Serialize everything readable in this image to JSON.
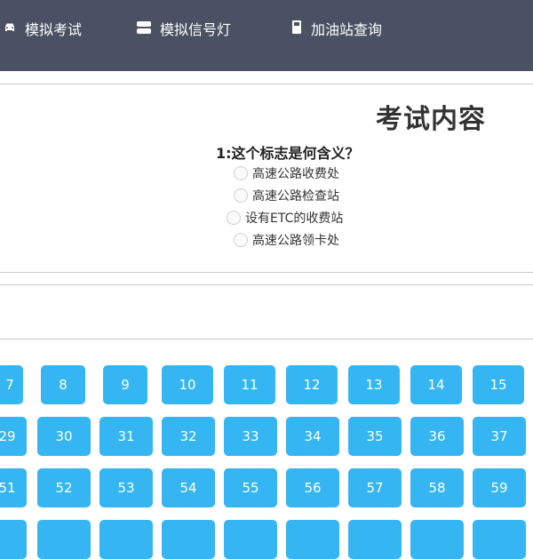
{
  "nav": {
    "items": [
      {
        "icon": "car-icon",
        "label": "模拟考试"
      },
      {
        "icon": "traffic-light-icon",
        "label": "模拟信号灯"
      },
      {
        "icon": "fuel-pump-icon",
        "label": "加油站查询"
      }
    ]
  },
  "exam": {
    "title": "考试内容",
    "question": "1:这个标志是何含义？",
    "options": [
      "高速公路收费处",
      "高速公路检查站",
      "设有ETC的收费站",
      "高速公路领卡处"
    ]
  },
  "grid": {
    "rows": [
      [
        "7",
        "8",
        "9",
        "10",
        "11",
        "12",
        "13",
        "14",
        "15"
      ],
      [
        "29",
        "30",
        "31",
        "32",
        "33",
        "34",
        "35",
        "36",
        "37"
      ],
      [
        "51",
        "52",
        "53",
        "54",
        "55",
        "56",
        "57",
        "58",
        "59"
      ],
      [
        "",
        "",
        "",
        "",
        "",
        "",
        "",
        "",
        ""
      ]
    ]
  },
  "colors": {
    "navbar": "#4a5162",
    "number_button": "#35b6f2"
  }
}
